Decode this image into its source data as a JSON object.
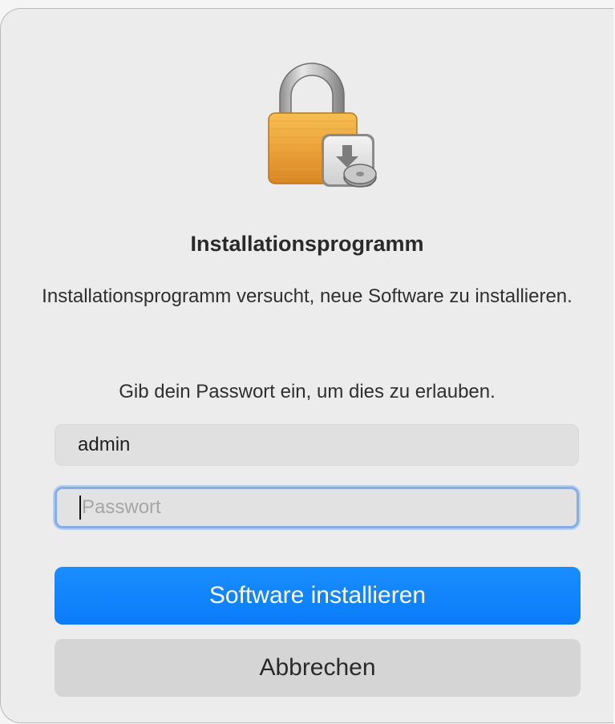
{
  "dialog": {
    "app_icon": "lock-installer-icon",
    "title": "Installationsprogramm",
    "message": "Installationsprogramm versucht, neue Software zu installieren.",
    "prompt": "Gib dein Passwort ein, um dies zu erlauben."
  },
  "form": {
    "username_value": "admin",
    "password_placeholder": "Passwort"
  },
  "buttons": {
    "install_label": "Software installieren",
    "cancel_label": "Abbrechen"
  },
  "colors": {
    "accent": "#0a7cf8",
    "focus_ring": "#86aee6",
    "lock_gold": "#f0a73a"
  }
}
